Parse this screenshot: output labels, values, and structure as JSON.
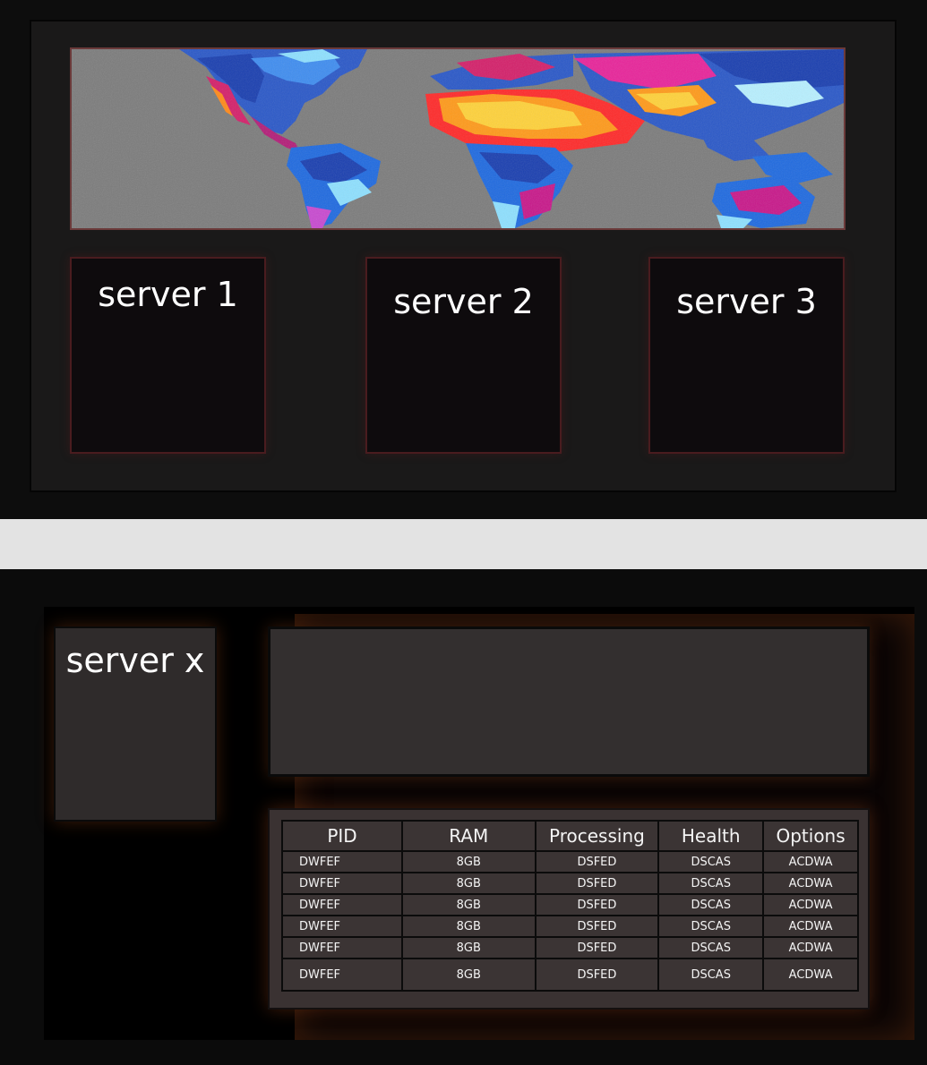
{
  "overview": {
    "servers": [
      {
        "label": "server 1"
      },
      {
        "label": "server 2"
      },
      {
        "label": "server 3"
      }
    ]
  },
  "detail": {
    "server_label": "server x",
    "table": {
      "headers": [
        "PID",
        "RAM",
        "Processing",
        "Health",
        "Options"
      ],
      "rows": [
        [
          "DWFEF",
          "8GB",
          "DSFED",
          "DSCAS",
          "ACDWA"
        ],
        [
          "DWFEF",
          "8GB",
          "DSFED",
          "DSCAS",
          "ACDWA"
        ],
        [
          "DWFEF",
          "8GB",
          "DSFED",
          "DSCAS",
          "ACDWA"
        ],
        [
          "DWFEF",
          "8GB",
          "DSFED",
          "DSCAS",
          "ACDWA"
        ],
        [
          "DWFEF",
          "8GB",
          "DSFED",
          "DSCAS",
          "ACDWA"
        ],
        [
          "DWFEF",
          "8GB",
          "DSFED",
          "DSCAS",
          "ACDWA"
        ]
      ]
    }
  },
  "colors": {
    "page_divider": "#e3e3e3",
    "card_border": "#4a1c1f",
    "map_ocean": "#7c7c7c",
    "glow": "#8c3c14"
  },
  "icons": {
    "map": "world-heatmap-image"
  }
}
